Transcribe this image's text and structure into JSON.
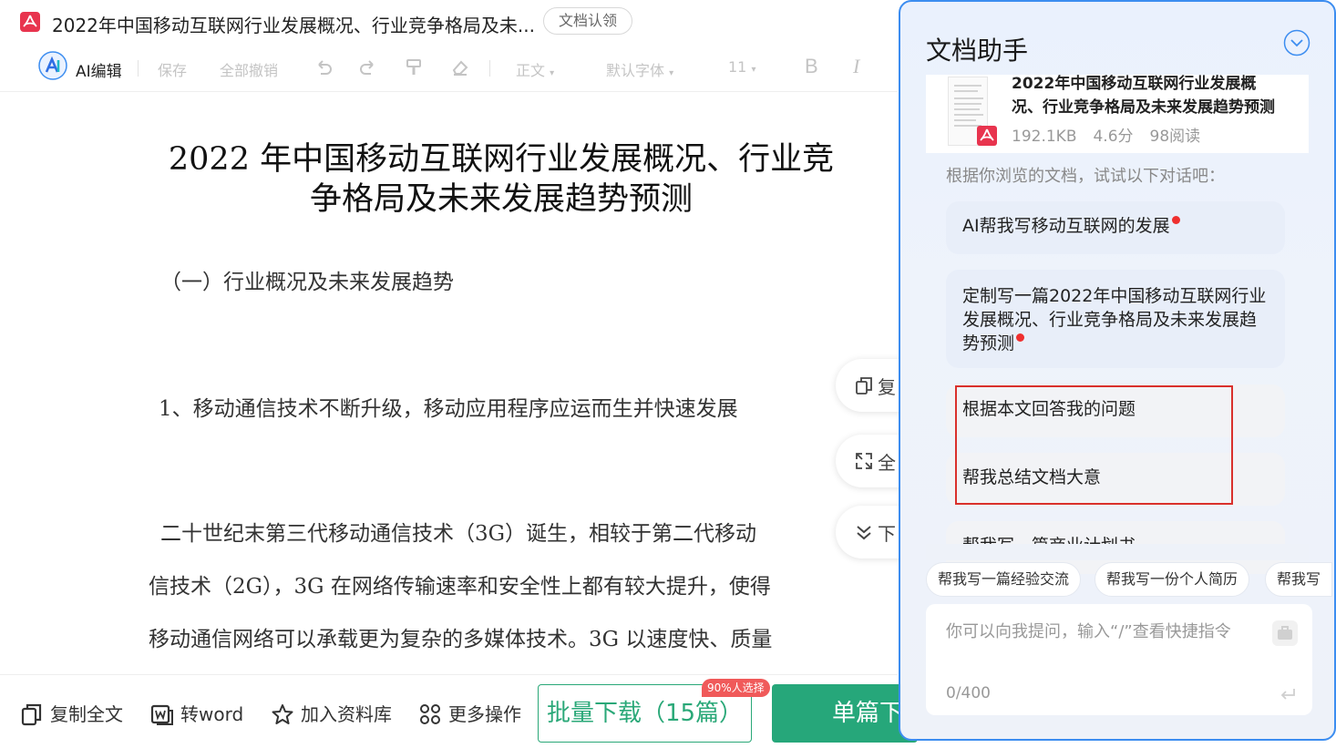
{
  "header": {
    "doc_title": "2022年中国移动互联网行业发展概况、行业竞争格局及未...",
    "claim_label": "文档认领"
  },
  "toolbar": {
    "ai_edit": "AI编辑",
    "save": "保存",
    "undo_all": "全部撤销",
    "para_style": "正文",
    "font": "默认字体",
    "font_size": "11",
    "bold": "B",
    "italic": "I"
  },
  "document": {
    "title": "2022 年中国移动互联网行业发展概况、行业竞争格局及未来发展趋势预测",
    "title_line1": "2022 年中国移动互联网行业发展概况、行业竞",
    "title_line2": "争格局及未来发展趋势预测",
    "section_heading": "（一）行业概况及未来发展趋势",
    "subheading": "1、移动通信技术不断升级，移动应用程序应运而生并快速发展",
    "para_line1": "二十世纪末第三代移动通信技术（3G）诞生，相较于第二代移动",
    "para_line2": "信技术（2G），3G 在网络传输速率和安全性上都有较大提升，使得",
    "para_line3": "移动通信网络可以承载更为复杂的多媒体技术。3G 以速度快、质量"
  },
  "floating": {
    "copy": "复",
    "fullscreen": "全",
    "down": "下"
  },
  "bottom": {
    "copy_all": "复制全文",
    "to_word": "转word",
    "add_library": "加入资料库",
    "more": "更多操作",
    "batch_download": "批量下载（15篇）",
    "batch_badge": "90%人选择",
    "single_download": "单篇下"
  },
  "assistant": {
    "title": "文档助手",
    "card": {
      "title": "2022年中国移动互联网行业发展概况、行业竞争格局及未来发展趋势预测",
      "size": "192.1KB",
      "score": "4.6分",
      "reads": "98阅读"
    },
    "hint": "根据你浏览的文档，试试以下对话吧：",
    "suggestions": [
      "AI帮我写移动互联网的发展",
      "定制写一篇2022年中国移动互联网行业发展概况、行业竞争格局及未来发展趋势预测",
      "根据本文回答我的问题",
      "帮我总结文档大意",
      "帮我写一篇商业计划书"
    ],
    "chips": [
      "帮我写一篇经验交流",
      "帮我写一份个人简历",
      "帮我写"
    ],
    "input_placeholder": "你可以向我提问，输入“/”查看快捷指令",
    "input_count": "0/400"
  },
  "colors": {
    "accent": "#3c8df0",
    "download_green": "#26a77a",
    "pdf_red": "#e8344e",
    "highlight_red": "#d9302c"
  }
}
